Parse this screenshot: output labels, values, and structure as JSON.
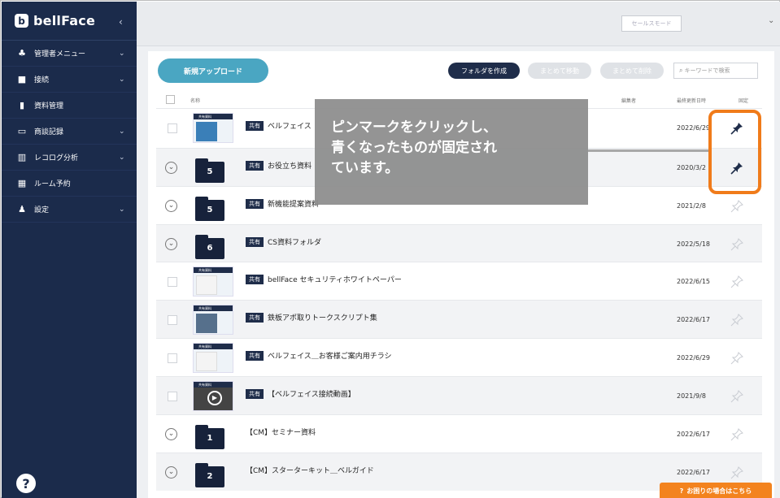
{
  "sidebar": {
    "logo": "bellFace",
    "collapse": "‹",
    "items": [
      {
        "label": "管理者メニュー",
        "icon": "people-icon",
        "caret": "⌄"
      },
      {
        "label": "接続",
        "icon": "video-icon",
        "caret": "⌄"
      },
      {
        "label": "資料管理",
        "icon": "document-icon",
        "caret": ""
      },
      {
        "label": "商談記録",
        "icon": "archive-icon",
        "caret": "⌄"
      },
      {
        "label": "レコログ分析",
        "icon": "chart-icon",
        "caret": "⌄"
      },
      {
        "label": "ルーム予約",
        "icon": "calendar-icon",
        "caret": ""
      },
      {
        "label": "設定",
        "icon": "user-gear-icon",
        "caret": "⌄"
      }
    ],
    "help": "?"
  },
  "topbar": {
    "mode": "セールスモード",
    "user_caret": "⌄"
  },
  "toolbar": {
    "upload": "新規アップロード",
    "create_folder": "フォルダを作成",
    "move_all": "まとめて移動",
    "delete_all": "まとめて削除",
    "search_placeholder": "キーワードで検索"
  },
  "table": {
    "headers": {
      "name": "名称",
      "editor": "編集者",
      "date": "最終更新日時",
      "pin": "固定"
    },
    "rows": [
      {
        "kind": "file",
        "thumb": "共有資料",
        "tag": "共有",
        "title": "ベルフェイス",
        "date": "2022/6/29",
        "pinned": true
      },
      {
        "kind": "folder",
        "count": "5",
        "tag": "共有",
        "title": "お役立ち資料",
        "date": "2020/3/2",
        "pinned": true
      },
      {
        "kind": "folder",
        "count": "5",
        "tag": "共有",
        "title": "新機能提案資料",
        "date": "2021/2/8",
        "pinned": false
      },
      {
        "kind": "folder",
        "count": "6",
        "tag": "共有",
        "title": "CS資料フォルダ",
        "date": "2022/5/18",
        "pinned": false
      },
      {
        "kind": "file",
        "thumb": "共有資料",
        "tag": "共有",
        "title": "bellFace セキュリティホワイトペーパー",
        "date": "2022/6/15",
        "pinned": false
      },
      {
        "kind": "file",
        "thumb": "共有資料",
        "tag": "共有",
        "title": "鉄板アポ取りトークスクリプト集",
        "date": "2022/6/17",
        "pinned": false
      },
      {
        "kind": "file",
        "thumb": "共有資料",
        "tag": "共有",
        "title": "ベルフェイス＿お客様ご案内用チラシ",
        "date": "2022/6/29",
        "pinned": false
      },
      {
        "kind": "video",
        "thumb": "共有資料",
        "tag": "共有",
        "title": "【ベルフェイス接続動画】",
        "date": "2021/9/8",
        "pinned": false
      },
      {
        "kind": "folder",
        "count": "1",
        "tag": "",
        "title": "【CM】セミナー資料",
        "date": "2022/6/17",
        "pinned": false
      },
      {
        "kind": "folder",
        "count": "2",
        "tag": "",
        "title": "【CM】スターターキット＿ベルガイド",
        "date": "2022/6/17",
        "pinned": false
      }
    ]
  },
  "callout": {
    "line1": "ピンマークをクリックし、",
    "line2": "青くなったものが固定され",
    "line3": "ています。"
  },
  "help_button": "お困りの場合はこちら",
  "colors": {
    "sidebar": "#1b2b4b",
    "accent": "#4aa6c2",
    "highlight": "#f07b1a",
    "pin_active": "#1f2d4a",
    "pin_inactive": "#c9ccd2"
  }
}
